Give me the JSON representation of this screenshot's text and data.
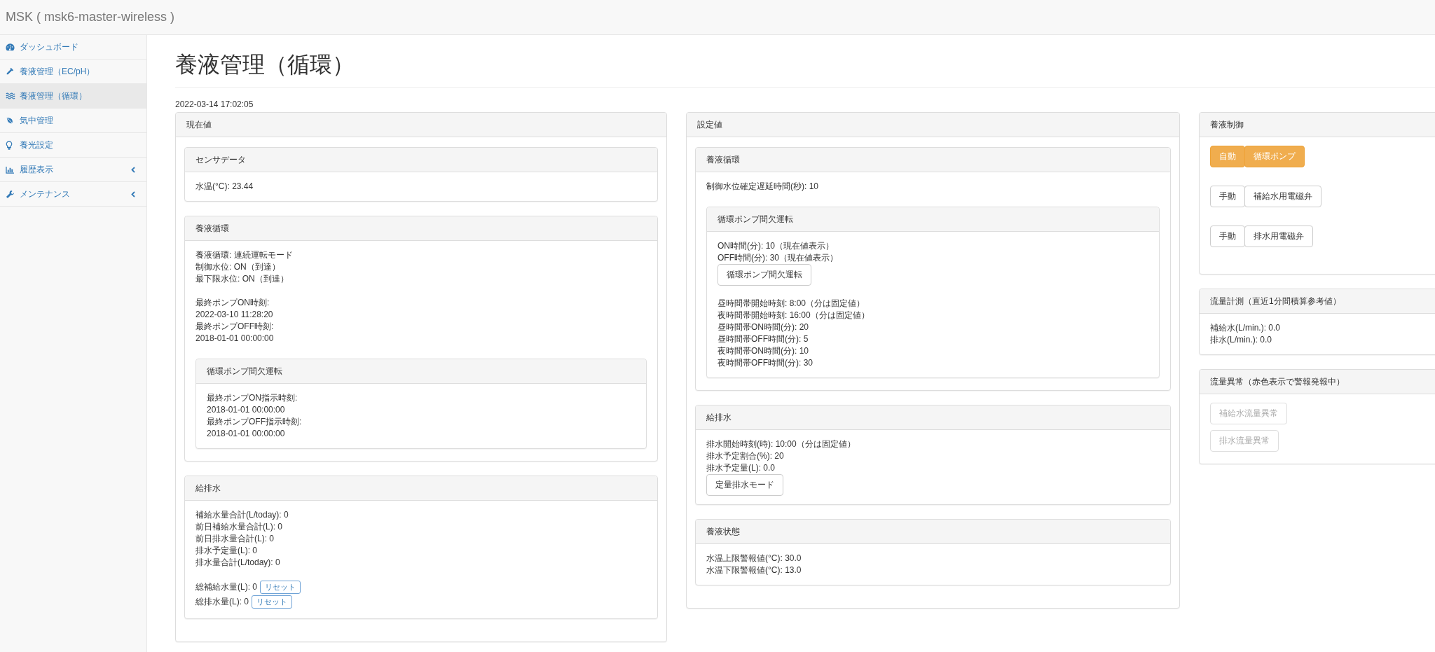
{
  "navbar": {
    "brand": "MSK ( msk6-master-wireless )"
  },
  "sidebar": {
    "items": [
      {
        "label": "ダッシュボード",
        "selected": false,
        "expandable": false
      },
      {
        "label": "養液管理（EC/pH）",
        "selected": false,
        "expandable": false
      },
      {
        "label": "養液管理（循環）",
        "selected": true,
        "expandable": false
      },
      {
        "label": "気中管理",
        "selected": false,
        "expandable": false
      },
      {
        "label": "養光設定",
        "selected": false,
        "expandable": false
      },
      {
        "label": "履歴表示",
        "selected": false,
        "expandable": true
      },
      {
        "label": "メンテナンス",
        "selected": false,
        "expandable": true
      }
    ]
  },
  "page": {
    "title": "養液管理（循環）",
    "timestamp": "2022-03-14 17:02:05"
  },
  "columns": [
    {
      "kind": "outer",
      "title": "現在値",
      "panels": [
        {
          "title": "センサデータ",
          "items": [
            {
              "kind": "lines",
              "lines": [
                "水温(°C): 23.44"
              ]
            }
          ]
        },
        {
          "title": "養液循環",
          "items": [
            {
              "kind": "lines",
              "lines": [
                "養液循環: 連続運転モード",
                "制御水位: ON（到達）",
                "最下限水位: ON（到達）"
              ]
            },
            {
              "kind": "blank"
            },
            {
              "kind": "lines",
              "lines": [
                "最終ポンプON時刻:",
                "2022-03-10 11:28:20",
                "最終ポンプOFF時刻:",
                "2018-01-01 00:00:00"
              ]
            },
            {
              "kind": "panel",
              "title": "循環ポンプ間欠運転",
              "items": [
                {
                  "kind": "lines",
                  "lines": [
                    "最終ポンプON指示時刻:",
                    "2018-01-01 00:00:00",
                    "最終ポンプOFF指示時刻:",
                    "2018-01-01 00:00:00"
                  ]
                }
              ]
            }
          ]
        },
        {
          "title": "給排水",
          "items": [
            {
              "kind": "lines",
              "lines": [
                "補給水量合計(L/today): 0",
                "前日補給水量合計(L): 0",
                "前日排水量合計(L): 0",
                "排水予定量(L): 0",
                "排水量合計(L/today): 0"
              ]
            },
            {
              "kind": "blank"
            },
            {
              "kind": "value_reset",
              "text": "総補給水量(L): 0",
              "button": "リセット"
            },
            {
              "kind": "value_reset",
              "text": "総排水量(L): 0",
              "button": "リセット"
            }
          ]
        }
      ]
    },
    {
      "kind": "outer",
      "title": "設定値",
      "panels": [
        {
          "title": "養液循環",
          "items": [
            {
              "kind": "lines",
              "lines": [
                "制御水位確定遅延時間(秒): 10"
              ]
            },
            {
              "kind": "panel",
              "title": "循環ポンプ間欠運転",
              "items": [
                {
                  "kind": "lines",
                  "lines": [
                    "ON時間(分): 10（現在値表示）",
                    "OFF時間(分): 30（現在値表示）"
                  ]
                },
                {
                  "kind": "button",
                  "label": "循環ポンプ間欠運転"
                },
                {
                  "kind": "blank"
                },
                {
                  "kind": "lines",
                  "lines": [
                    "昼時間帯開始時刻: 8:00（分は固定値）",
                    "夜時間帯開始時刻: 16:00（分は固定値）",
                    "昼時間帯ON時間(分): 20",
                    "昼時間帯OFF時間(分): 5",
                    "夜時間帯ON時間(分): 10",
                    "夜時間帯OFF時間(分): 30"
                  ]
                }
              ]
            }
          ]
        },
        {
          "title": "給排水",
          "items": [
            {
              "kind": "lines",
              "lines": [
                "排水開始時刻(時): 10:00（分は固定値）",
                "排水予定割合(%): 20",
                "排水予定量(L): 0.0"
              ]
            },
            {
              "kind": "button",
              "label": "定量排水モード"
            }
          ]
        },
        {
          "title": "養液状態",
          "items": [
            {
              "kind": "lines",
              "lines": [
                "水温上限警報値(°C): 30.0",
                "水温下限警報値(°C): 13.0"
              ]
            }
          ]
        }
      ]
    },
    {
      "kind": "stack",
      "panels": [
        {
          "title": "養液制御",
          "items": [
            {
              "kind": "button_group",
              "buttons": [
                {
                  "label": "自動",
                  "active": true
                },
                {
                  "label": "循環ポンプ",
                  "active": true
                }
              ]
            },
            {
              "kind": "button_group",
              "buttons": [
                {
                  "label": "手動",
                  "active": false
                },
                {
                  "label": "補給水用電磁弁",
                  "active": false
                }
              ]
            },
            {
              "kind": "button_group",
              "buttons": [
                {
                  "label": "手動",
                  "active": false
                },
                {
                  "label": "排水用電磁弁",
                  "active": false
                }
              ]
            }
          ]
        },
        {
          "title": "流量計測（直近1分間積算参考値）",
          "items": [
            {
              "kind": "lines",
              "lines": [
                "補給水(L/min.): 0.0",
                "排水(L/min.): 0.0"
              ]
            }
          ]
        },
        {
          "title": "流量異常（赤色表示で警報発報中）",
          "items": [
            {
              "kind": "button_stack",
              "buttons": [
                {
                  "label": "補給水流量異常",
                  "alarm": false
                },
                {
                  "label": "排水流量異常",
                  "alarm": false
                }
              ]
            }
          ]
        }
      ]
    }
  ]
}
